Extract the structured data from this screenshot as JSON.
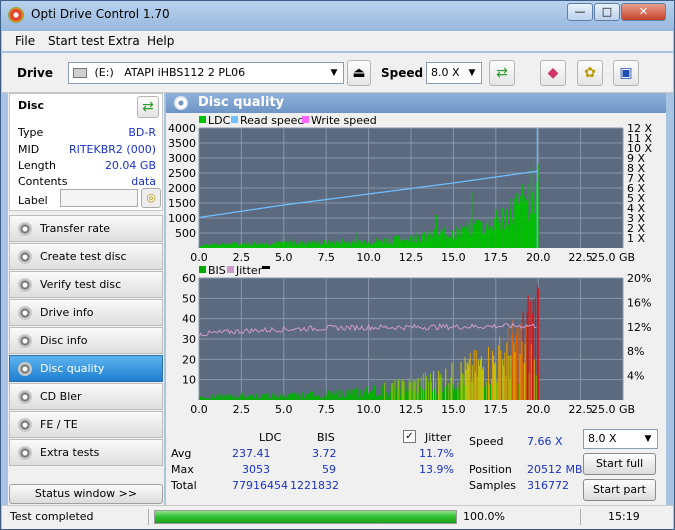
{
  "window": {
    "title": "Opti Drive Control 1.70",
    "min": "—",
    "max": "□",
    "close": "✕"
  },
  "menu": {
    "file": "File",
    "start_test": "Start test",
    "extra": "Extra",
    "help": "Help"
  },
  "toolbar": {
    "drive_label": "Drive",
    "drive_letter": "(E:)",
    "drive_name": "ATAPI iHBS112   2 PL06",
    "speed_label": "Speed",
    "speed_value": "8.0 X"
  },
  "disc": {
    "header": "Disc",
    "type_label": "Type",
    "type_value": "BD-R",
    "mid_label": "MID",
    "mid_value": "RITEKBR2 (000)",
    "length_label": "Length",
    "length_value": "20.04 GB",
    "contents_label": "Contents",
    "contents_value": "data",
    "label_label": "Label",
    "label_value": ""
  },
  "nav": [
    {
      "label": "Transfer rate"
    },
    {
      "label": "Create test disc"
    },
    {
      "label": "Verify test disc"
    },
    {
      "label": "Drive info"
    },
    {
      "label": "Disc info"
    },
    {
      "label": "Disc quality"
    },
    {
      "label": "CD Bler"
    },
    {
      "label": "FE / TE"
    },
    {
      "label": "Extra tests"
    }
  ],
  "nav_active": 5,
  "status_window_button": "Status window >>",
  "panel_title": "Disc quality",
  "colors": {
    "ldc": "#00c000",
    "read": "#6fc0ff",
    "write": "#ff66ff",
    "bis": "#00aa00",
    "jitter": "#cc99cc",
    "plot_bg": "#5c6a80",
    "grid": "#8896aa"
  },
  "chart_data": [
    {
      "type": "bar",
      "legend": [
        "LDC",
        "Read speed",
        "Write speed"
      ],
      "x_ticks": [
        "0.0",
        "2.5",
        "5.0",
        "7.5",
        "10.0",
        "12.5",
        "15.0",
        "17.5",
        "20.0",
        "22.5",
        "25.0 GB"
      ],
      "y_ticks": [
        "500",
        "1000",
        "1500",
        "2000",
        "2500",
        "3000",
        "3500",
        "4000"
      ],
      "y2_ticks": [
        "1 X",
        "2 X",
        "3 X",
        "4 X",
        "5 X",
        "6 X",
        "7 X",
        "8 X",
        "9 X",
        "10 X",
        "11 X",
        "12 X"
      ],
      "xlim": [
        0,
        25
      ],
      "ylim": [
        0,
        4000
      ],
      "y2lim": [
        0,
        12
      ],
      "ldc_profile": [
        [
          0,
          150
        ],
        [
          2.5,
          200
        ],
        [
          5,
          220
        ],
        [
          7.5,
          250
        ],
        [
          10,
          300
        ],
        [
          12.5,
          450
        ],
        [
          15,
          700
        ],
        [
          17.5,
          1200
        ],
        [
          19,
          2000
        ],
        [
          19.8,
          2800
        ],
        [
          20.0,
          3053
        ]
      ],
      "read_speed": [
        [
          0,
          3.05
        ],
        [
          5,
          4.3
        ],
        [
          10,
          5.4
        ],
        [
          15,
          6.5
        ],
        [
          20.0,
          7.7
        ]
      ]
    },
    {
      "type": "bar",
      "legend": [
        "BIS",
        "Jitter"
      ],
      "x_ticks": [
        "0.0",
        "2.5",
        "5.0",
        "7.5",
        "10.0",
        "12.5",
        "15.0",
        "17.5",
        "20.0",
        "22.5",
        "25.0 GB"
      ],
      "y_ticks": [
        "10",
        "20",
        "30",
        "40",
        "50",
        "60"
      ],
      "y2_ticks": [
        "4%",
        "8%",
        "12%",
        "16%",
        "20%"
      ],
      "xlim": [
        0,
        25
      ],
      "ylim": [
        0,
        60
      ],
      "y2lim": [
        0,
        20
      ],
      "bis_profile": [
        [
          0,
          2
        ],
        [
          2.5,
          3
        ],
        [
          5,
          3
        ],
        [
          7.5,
          4
        ],
        [
          10,
          6
        ],
        [
          12.5,
          10
        ],
        [
          15,
          16
        ],
        [
          17.5,
          26
        ],
        [
          19,
          38
        ],
        [
          20.0,
          59
        ]
      ],
      "jitter": [
        [
          0,
          10.8
        ],
        [
          2.5,
          11.3
        ],
        [
          5,
          11.6
        ],
        [
          7.5,
          11.8
        ],
        [
          10,
          11.9
        ],
        [
          15,
          12.0
        ],
        [
          20.0,
          12.2
        ]
      ]
    }
  ],
  "stats": {
    "col_ldc": "LDC",
    "col_bis": "BIS",
    "jitter_label": "Jitter",
    "avg_label": "Avg",
    "avg_ldc": "237.41",
    "avg_bis": "3.72",
    "avg_jitter": "11.7%",
    "max_label": "Max",
    "max_ldc": "3053",
    "max_bis": "59",
    "max_jitter": "13.9%",
    "total_label": "Total",
    "total_ldc": "77916454",
    "total_bis": "1221832",
    "speed_label": "Speed",
    "speed_value": "7.66 X",
    "position_label": "Position",
    "position_value": "20512 MB",
    "samples_label": "Samples",
    "samples_value": "316772",
    "speed_select": "8.0 X",
    "start_full": "Start full",
    "start_part": "Start part"
  },
  "status": {
    "text": "Test completed",
    "percent": "100.0%",
    "progress": 1.0,
    "time": "15:19"
  }
}
